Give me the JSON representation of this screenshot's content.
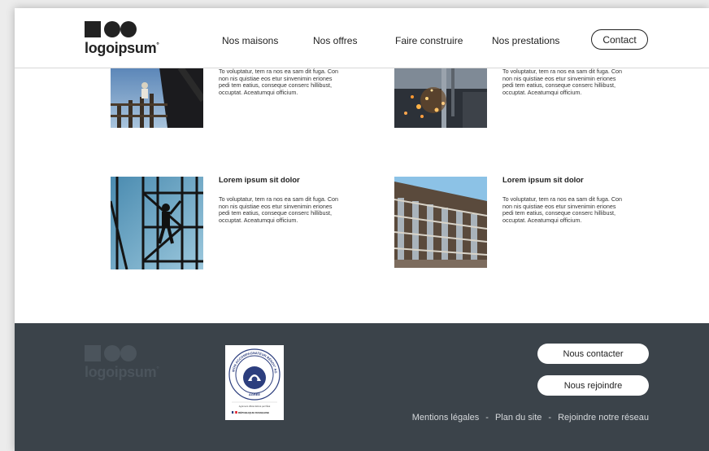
{
  "brand": {
    "name": "logoipsum",
    "trademark": "°"
  },
  "nav": {
    "items": [
      "Nos maisons",
      "Nos offres",
      "Faire construire",
      "Nos prestations"
    ],
    "contact_label": "Contact"
  },
  "cards": [
    {
      "title": "",
      "text": "To voluptatur, tem ra nos ea sam dit fuga. Con non nis quistiae eos etur sinvenimin eriones pedi tem eatius, conseque conserc hillibust, occuptat. Aceatumqui officium."
    },
    {
      "title": "",
      "text": "To voluptatur, tem ra nos ea sam dit fuga. Con non nis quistiae eos etur sinvenimin eriones pedi tem eatius, conseque conserc hillibust, occuptat. Aceatumqui officium."
    },
    {
      "title": "Lorem ipsum sit dolor",
      "text": "To voluptatur, tem ra nos ea sam dit fuga. Con non nis quistiae eos etur sinvenimin eriones pedi tem eatius, conseque conserc hillibust, occuptat. Aceatumqui officium."
    },
    {
      "title": "Lorem ipsum sit dolor",
      "text": "To voluptatur, tem ra nos ea sam dit fuga. Con non nis quistiae eos etur sinvenimin eriones pedi tem eatius, conseque conserc hillibust, occuptat. Aceatumqui officium."
    }
  ],
  "footer": {
    "buttons": [
      "Nous contacter",
      "Nous rejoindre"
    ],
    "links": [
      "Mentions légales",
      "Plan du site",
      "Rejoindre notre réseau"
    ],
    "separator": "-",
    "badge": {
      "ring_text": "MON ACCOMPAGNATEUR RÉNOV' AGRÉÉ",
      "label": "AGRÉÉ",
      "small_print": "Agrément officiel délivré par l'État",
      "republic": "RÉPUBLIQUE FRANÇAISE"
    }
  },
  "colors": {
    "footer_bg": "#3b434a",
    "text": "#222222",
    "footer_link": "#d6d9dc",
    "badge_blue": "#2c3e7e"
  }
}
